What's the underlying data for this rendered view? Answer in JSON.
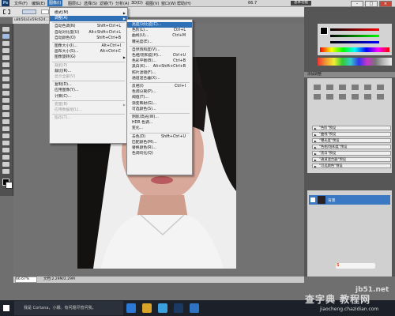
{
  "menubar": {
    "ps_logo": "Ps",
    "items": [
      "文件(F)",
      "编辑(E)",
      "图像(I)",
      "图层(L)",
      "选择(S)",
      "滤镜(T)",
      "分析(A)",
      "3D(D)",
      "视图(V)",
      "窗口(W)",
      "帮助(H)"
    ],
    "zoom": "66.7",
    "essentials": "基本功能",
    "win_min": "–",
    "win_max": "□",
    "win_close": "×"
  },
  "document": {
    "tab_label": "u8b56a1e59c624...",
    "zoom_status": "66.67%",
    "doc_status": "文档:2.29M/2.29M"
  },
  "image_menu": {
    "rows": [
      {
        "label": "模式(M)",
        "shortcut": "",
        "arrow": true,
        "disabled": false
      },
      {
        "label": "调整(A)",
        "shortcut": "",
        "arrow": true,
        "disabled": false,
        "highlight": true
      },
      {
        "label": "自动色调(N)",
        "shortcut": "Shift+Ctrl+L",
        "disabled": false
      },
      {
        "label": "自动对比度(U)",
        "shortcut": "Alt+Shift+Ctrl+L",
        "disabled": false
      },
      {
        "label": "自动颜色(O)",
        "shortcut": "Shift+Ctrl+B",
        "disabled": false
      },
      {
        "label": "图像大小(I)...",
        "shortcut": "Alt+Ctrl+I",
        "disabled": false
      },
      {
        "label": "画布大小(S)...",
        "shortcut": "Alt+Ctrl+C",
        "disabled": false
      },
      {
        "label": "图像旋转(G)",
        "shortcut": "",
        "arrow": true,
        "disabled": false
      },
      {
        "label": "裁剪(P)",
        "shortcut": "",
        "disabled": true
      },
      {
        "label": "裁切(R)...",
        "shortcut": "",
        "disabled": false
      },
      {
        "label": "显示全部(V)",
        "shortcut": "",
        "disabled": true
      },
      {
        "label": "复制(D)...",
        "shortcut": "",
        "disabled": false
      },
      {
        "label": "应用图像(Y)...",
        "shortcut": "",
        "disabled": false
      },
      {
        "label": "计算(C)...",
        "shortcut": "",
        "disabled": false
      },
      {
        "label": "变量(B)",
        "shortcut": "",
        "arrow": true,
        "disabled": true
      },
      {
        "label": "应用数据组(L)...",
        "shortcut": "",
        "disabled": true
      },
      {
        "label": "陷印(T)...",
        "shortcut": "",
        "disabled": true
      }
    ]
  },
  "adjust_menu": {
    "rows": [
      {
        "label": "亮度/对比度(C)...",
        "shortcut": "",
        "highlight": true
      },
      {
        "label": "色阶(L)...",
        "shortcut": "Ctrl+L"
      },
      {
        "label": "曲线(U)...",
        "shortcut": "Ctrl+M"
      },
      {
        "label": "曝光度(E)...",
        "shortcut": ""
      },
      {
        "label": "自然饱和度(V)...",
        "shortcut": ""
      },
      {
        "label": "色相/饱和度(H)...",
        "shortcut": "Ctrl+U"
      },
      {
        "label": "色彩平衡(B)...",
        "shortcut": "Ctrl+B"
      },
      {
        "label": "黑白(K)...",
        "shortcut": "Alt+Shift+Ctrl+B"
      },
      {
        "label": "照片滤镜(F)...",
        "shortcut": ""
      },
      {
        "label": "通道混合器(X)...",
        "shortcut": ""
      },
      {
        "label": "反相(I)",
        "shortcut": "Ctrl+I"
      },
      {
        "label": "色调分离(P)...",
        "shortcut": ""
      },
      {
        "label": "阈值(T)...",
        "shortcut": ""
      },
      {
        "label": "渐变映射(G)...",
        "shortcut": ""
      },
      {
        "label": "可选颜色(S)...",
        "shortcut": ""
      },
      {
        "label": "阴影/高光(W)...",
        "shortcut": ""
      },
      {
        "label": "HDR 色调...",
        "shortcut": ""
      },
      {
        "label": "变化...",
        "shortcut": ""
      },
      {
        "label": "去色(D)",
        "shortcut": "Shift+Ctrl+U"
      },
      {
        "label": "匹配颜色(M)...",
        "shortcut": ""
      },
      {
        "label": "替换颜色(R)...",
        "shortcut": ""
      },
      {
        "label": "色调均化(Q)",
        "shortcut": ""
      }
    ]
  },
  "right_panel": {
    "adjust_header": "添加调整",
    "presets": [
      "\"色阶\"预设",
      "\"曲线\"预设",
      "\"曝光度\"预设",
      "\"色相/饱和度\"预设",
      "\"黑白\"预设",
      "\"通道混合器\"预设",
      "\"可选颜色\"预设"
    ],
    "layer_name": "背景"
  },
  "taskbar": {
    "search_text": "我是 Cortana，小娜。有问题尽管问我。"
  },
  "watermark": {
    "line1": "jb51.net",
    "line2": "查字典 教程网",
    "line3": "jiaocheng.chazidian.com"
  },
  "colors": {
    "highlight": "#2f6fb5",
    "layer_selected": "#3a78c3"
  }
}
